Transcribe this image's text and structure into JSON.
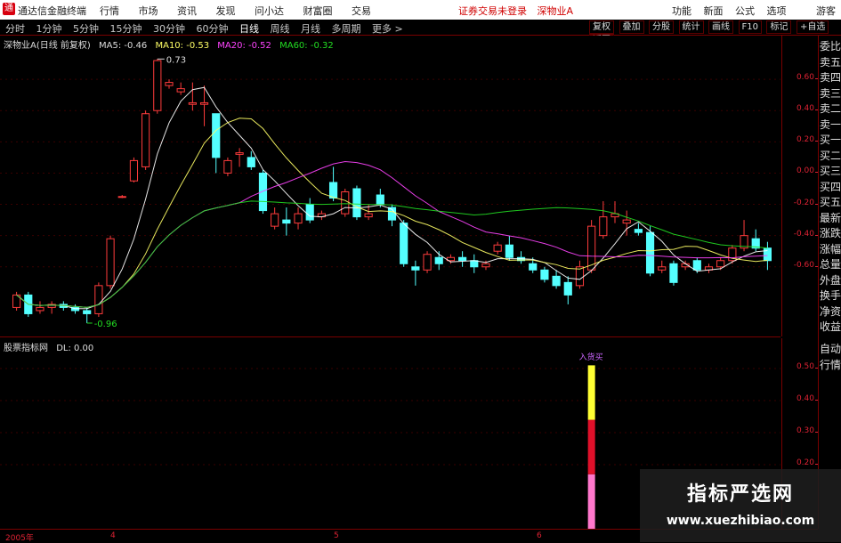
{
  "app": {
    "logo_text": "通",
    "title": "通达信金融终端"
  },
  "menu": [
    "行情",
    "市场",
    "资讯",
    "发现",
    "问小达",
    "财富圈",
    "交易"
  ],
  "status": {
    "login": "证券交易未登录",
    "stock": "深物业A"
  },
  "right_menu": [
    "功能",
    "新面",
    "公式",
    "选项"
  ],
  "right_user": "游客",
  "periods": [
    "分时",
    "1分钟",
    "5分钟",
    "15分钟",
    "30分钟",
    "60分钟",
    "日线",
    "周线",
    "月线",
    "多周期",
    "更多 >"
  ],
  "active_period": "日线",
  "tool_buttons": [
    "复权",
    "叠加",
    "分股",
    "统计",
    "画线",
    "F10",
    "标记",
    "+自选",
    "返回"
  ],
  "side_tab": "L",
  "main_legend": {
    "title": "深物业A(日线 前复权)",
    "ma5": "MA5: -0.46",
    "ma10": "MA10: -0.53",
    "ma20": "MA20: -0.52",
    "ma60": "MA60: -0.32"
  },
  "sub_legend": {
    "title": "股票指标网",
    "dl": "DL: 0.00"
  },
  "annotations": {
    "high": "0.73",
    "low": "-0.96",
    "signal": "入货买"
  },
  "y_axis_main": [
    "0.60",
    "0.40",
    "0.20",
    "0.00",
    "-0.20",
    "-0.40",
    "-0.60"
  ],
  "y_axis_sub": [
    "0.50",
    "0.40",
    "0.30",
    "0.20"
  ],
  "date_labels": [
    "2005年",
    "4",
    "5",
    "6"
  ],
  "right_column": [
    "委比",
    "卖五",
    "卖四",
    "卖三",
    "卖二",
    "卖一",
    "买一",
    "买二",
    "买三",
    "买四",
    "买五",
    "最新",
    "涨跌",
    "涨幅",
    "总量",
    "外盘",
    "换手",
    "净资",
    "收益"
  ],
  "right_column_sub": [
    "自动",
    "行情"
  ],
  "watermark": {
    "line1": "指标严选网",
    "line2": "www.xuezhibiao.com"
  },
  "colors": {
    "up": "#ff3c3c",
    "down": "#54ffff",
    "ma5": "#ffffff",
    "ma10": "#ffff66",
    "ma20": "#ff44ff",
    "ma60": "#22dd22"
  },
  "chart_data": [
    {
      "type": "candlestick",
      "title": "深物业A(日线 前复权)",
      "ylim": [
        -1.0,
        0.8
      ],
      "candles": [
        {
          "o": -0.86,
          "h": -0.76,
          "l": -0.88,
          "c": -0.78
        },
        {
          "o": -0.78,
          "h": -0.76,
          "l": -0.92,
          "c": -0.9
        },
        {
          "o": -0.88,
          "h": -0.82,
          "l": -0.9,
          "c": -0.86
        },
        {
          "o": -0.86,
          "h": -0.82,
          "l": -0.9,
          "c": -0.84
        },
        {
          "o": -0.84,
          "h": -0.82,
          "l": -0.88,
          "c": -0.86
        },
        {
          "o": -0.86,
          "h": -0.84,
          "l": -0.9,
          "c": -0.88
        },
        {
          "o": -0.88,
          "h": -0.86,
          "l": -0.96,
          "c": -0.9
        },
        {
          "o": -0.9,
          "h": -0.7,
          "l": -0.92,
          "c": -0.72
        },
        {
          "o": -0.72,
          "h": -0.4,
          "l": -0.74,
          "c": -0.42
        },
        {
          "o": -0.15,
          "h": -0.14,
          "l": -0.16,
          "c": -0.15
        },
        {
          "o": -0.05,
          "h": 0.1,
          "l": -0.06,
          "c": 0.08
        },
        {
          "o": 0.04,
          "h": 0.4,
          "l": 0.02,
          "c": 0.38
        },
        {
          "o": 0.4,
          "h": 0.73,
          "l": 0.38,
          "c": 0.72
        },
        {
          "o": 0.56,
          "h": 0.6,
          "l": 0.54,
          "c": 0.58
        },
        {
          "o": 0.52,
          "h": 0.58,
          "l": 0.5,
          "c": 0.54
        },
        {
          "o": 0.44,
          "h": 0.58,
          "l": 0.4,
          "c": 0.45
        },
        {
          "o": 0.44,
          "h": 0.56,
          "l": 0.3,
          "c": 0.45
        },
        {
          "o": 0.38,
          "h": 0.38,
          "l": 0.0,
          "c": 0.1
        },
        {
          "o": 0.0,
          "h": 0.1,
          "l": -0.02,
          "c": 0.08
        },
        {
          "o": 0.12,
          "h": 0.16,
          "l": 0.04,
          "c": 0.13
        },
        {
          "o": 0.1,
          "h": 0.14,
          "l": 0.02,
          "c": 0.04
        },
        {
          "o": 0.0,
          "h": 0.02,
          "l": -0.26,
          "c": -0.24
        },
        {
          "o": -0.34,
          "h": -0.22,
          "l": -0.36,
          "c": -0.26
        },
        {
          "o": -0.3,
          "h": -0.22,
          "l": -0.4,
          "c": -0.32
        },
        {
          "o": -0.32,
          "h": -0.22,
          "l": -0.36,
          "c": -0.26
        },
        {
          "o": -0.2,
          "h": -0.16,
          "l": -0.32,
          "c": -0.3
        },
        {
          "o": -0.28,
          "h": -0.24,
          "l": -0.3,
          "c": -0.26
        },
        {
          "o": -0.06,
          "h": 0.04,
          "l": -0.18,
          "c": -0.16
        },
        {
          "o": -0.26,
          "h": -0.1,
          "l": -0.28,
          "c": -0.12
        },
        {
          "o": -0.1,
          "h": -0.08,
          "l": -0.3,
          "c": -0.28
        },
        {
          "o": -0.28,
          "h": -0.2,
          "l": -0.3,
          "c": -0.26
        },
        {
          "o": -0.14,
          "h": -0.1,
          "l": -0.22,
          "c": -0.2
        },
        {
          "o": -0.22,
          "h": -0.2,
          "l": -0.34,
          "c": -0.3
        },
        {
          "o": -0.32,
          "h": -0.3,
          "l": -0.6,
          "c": -0.58
        },
        {
          "o": -0.6,
          "h": -0.56,
          "l": -0.72,
          "c": -0.62
        },
        {
          "o": -0.62,
          "h": -0.5,
          "l": -0.64,
          "c": -0.52
        },
        {
          "o": -0.54,
          "h": -0.5,
          "l": -0.62,
          "c": -0.58
        },
        {
          "o": -0.56,
          "h": -0.52,
          "l": -0.58,
          "c": -0.54
        },
        {
          "o": -0.54,
          "h": -0.5,
          "l": -0.6,
          "c": -0.56
        },
        {
          "o": -0.56,
          "h": -0.52,
          "l": -0.64,
          "c": -0.6
        },
        {
          "o": -0.6,
          "h": -0.56,
          "l": -0.62,
          "c": -0.58
        },
        {
          "o": -0.5,
          "h": -0.44,
          "l": -0.52,
          "c": -0.46
        },
        {
          "o": -0.46,
          "h": -0.4,
          "l": -0.56,
          "c": -0.54
        },
        {
          "o": -0.54,
          "h": -0.5,
          "l": -0.58,
          "c": -0.56
        },
        {
          "o": -0.58,
          "h": -0.54,
          "l": -0.64,
          "c": -0.62
        },
        {
          "o": -0.62,
          "h": -0.6,
          "l": -0.7,
          "c": -0.68
        },
        {
          "o": -0.66,
          "h": -0.62,
          "l": -0.74,
          "c": -0.72
        },
        {
          "o": -0.7,
          "h": -0.66,
          "l": -0.84,
          "c": -0.78
        },
        {
          "o": -0.72,
          "h": -0.56,
          "l": -0.74,
          "c": -0.6
        },
        {
          "o": -0.62,
          "h": -0.3,
          "l": -0.64,
          "c": -0.34
        },
        {
          "o": -0.4,
          "h": -0.18,
          "l": -0.42,
          "c": -0.28
        },
        {
          "o": -0.28,
          "h": -0.18,
          "l": -0.32,
          "c": -0.26
        },
        {
          "o": -0.32,
          "h": -0.24,
          "l": -0.4,
          "c": -0.3
        },
        {
          "o": -0.36,
          "h": -0.32,
          "l": -0.4,
          "c": -0.38
        },
        {
          "o": -0.38,
          "h": -0.34,
          "l": -0.66,
          "c": -0.64
        },
        {
          "o": -0.62,
          "h": -0.56,
          "l": -0.64,
          "c": -0.6
        },
        {
          "o": -0.58,
          "h": -0.56,
          "l": -0.72,
          "c": -0.7
        },
        {
          "o": -0.6,
          "h": -0.56,
          "l": -0.62,
          "c": -0.58
        },
        {
          "o": -0.56,
          "h": -0.54,
          "l": -0.64,
          "c": -0.62
        },
        {
          "o": -0.62,
          "h": -0.58,
          "l": -0.64,
          "c": -0.6
        },
        {
          "o": -0.6,
          "h": -0.54,
          "l": -0.62,
          "c": -0.56
        },
        {
          "o": -0.56,
          "h": -0.46,
          "l": -0.58,
          "c": -0.48
        },
        {
          "o": -0.48,
          "h": -0.3,
          "l": -0.5,
          "c": -0.4
        },
        {
          "o": -0.42,
          "h": -0.36,
          "l": -0.5,
          "c": -0.48
        },
        {
          "o": -0.48,
          "h": -0.44,
          "l": -0.62,
          "c": -0.56
        }
      ],
      "ma_lines": [
        "MA5",
        "MA10",
        "MA20",
        "MA60"
      ]
    },
    {
      "type": "bar",
      "title": "股票指标网",
      "ylim": [
        0.0,
        0.55
      ],
      "bar_index": 49,
      "segments": [
        {
          "from": 0.0,
          "to": 0.17,
          "color": "#ff77cc"
        },
        {
          "from": 0.17,
          "to": 0.34,
          "color": "#e0102a"
        },
        {
          "from": 0.34,
          "to": 0.51,
          "color": "#ffff33"
        }
      ]
    }
  ]
}
